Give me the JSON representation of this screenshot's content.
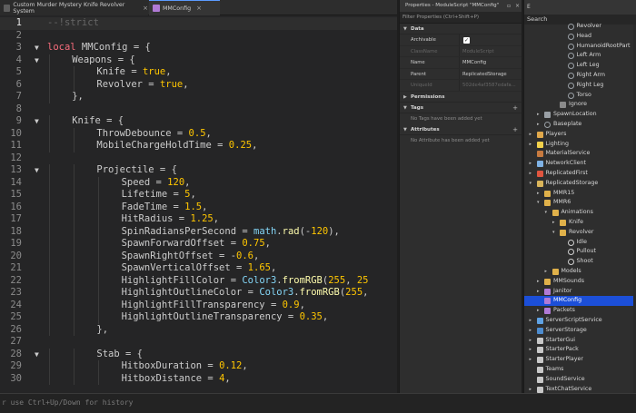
{
  "tabs": [
    {
      "label": "Custom Murder Mystery Knife Revolver System",
      "close": "×"
    },
    {
      "label": "MMConfig",
      "close": "×"
    }
  ],
  "code": [
    {
      "n": "1",
      "fold": "",
      "indent": 0,
      "toks": [
        [
          "cm",
          "--!strict"
        ]
      ]
    },
    {
      "n": "2",
      "fold": "",
      "indent": 0,
      "toks": []
    },
    {
      "n": "3",
      "fold": "▼",
      "indent": 0,
      "toks": [
        [
          "kw",
          "local"
        ],
        [
          "pl",
          " MMConfig = {"
        ]
      ]
    },
    {
      "n": "4",
      "fold": "▼",
      "indent": 1,
      "toks": [
        [
          "pl",
          "Weapons = {"
        ]
      ]
    },
    {
      "n": "5",
      "fold": "",
      "indent": 2,
      "toks": [
        [
          "pl",
          "Knife = "
        ],
        [
          "lit",
          "true"
        ],
        [
          "pl",
          ","
        ]
      ]
    },
    {
      "n": "6",
      "fold": "",
      "indent": 2,
      "toks": [
        [
          "pl",
          "Revolver = "
        ],
        [
          "lit",
          "true"
        ],
        [
          "pl",
          ","
        ]
      ]
    },
    {
      "n": "7",
      "fold": "",
      "indent": 1,
      "toks": [
        [
          "pl",
          "},"
        ]
      ]
    },
    {
      "n": "8",
      "fold": "",
      "indent": 0,
      "toks": []
    },
    {
      "n": "9",
      "fold": "▼",
      "indent": 1,
      "toks": [
        [
          "pl",
          "Knife = {"
        ]
      ]
    },
    {
      "n": "10",
      "fold": "",
      "indent": 2,
      "toks": [
        [
          "pl",
          "ThrowDebounce = "
        ],
        [
          "num",
          "0.5"
        ],
        [
          "pl",
          ","
        ]
      ]
    },
    {
      "n": "11",
      "fold": "",
      "indent": 2,
      "toks": [
        [
          "pl",
          "MobileChargeHoldTime = "
        ],
        [
          "num",
          "0.25"
        ],
        [
          "pl",
          ","
        ]
      ]
    },
    {
      "n": "12",
      "fold": "",
      "indent": 0,
      "toks": []
    },
    {
      "n": "13",
      "fold": "▼",
      "indent": 2,
      "toks": [
        [
          "pl",
          "Projectile = {"
        ]
      ]
    },
    {
      "n": "14",
      "fold": "",
      "indent": 3,
      "toks": [
        [
          "pl",
          "Speed = "
        ],
        [
          "num",
          "120"
        ],
        [
          "pl",
          ","
        ]
      ]
    },
    {
      "n": "15",
      "fold": "",
      "indent": 3,
      "toks": [
        [
          "pl",
          "Lifetime = "
        ],
        [
          "num",
          "5"
        ],
        [
          "pl",
          ","
        ]
      ]
    },
    {
      "n": "16",
      "fold": "",
      "indent": 3,
      "toks": [
        [
          "pl",
          "FadeTime = "
        ],
        [
          "num",
          "1.5"
        ],
        [
          "pl",
          ","
        ]
      ]
    },
    {
      "n": "17",
      "fold": "",
      "indent": 3,
      "toks": [
        [
          "pl",
          "HitRadius = "
        ],
        [
          "num",
          "1.25"
        ],
        [
          "pl",
          ","
        ]
      ]
    },
    {
      "n": "18",
      "fold": "",
      "indent": 3,
      "toks": [
        [
          "pl",
          "SpinRadiansPerSecond = "
        ],
        [
          "bi",
          "math"
        ],
        [
          "pl",
          "."
        ],
        [
          "fn",
          "rad"
        ],
        [
          "pl",
          "(-"
        ],
        [
          "num",
          "120"
        ],
        [
          "pl",
          "),"
        ]
      ]
    },
    {
      "n": "19",
      "fold": "",
      "indent": 3,
      "toks": [
        [
          "pl",
          "SpawnForwardOffset = "
        ],
        [
          "num",
          "0.75"
        ],
        [
          "pl",
          ","
        ]
      ]
    },
    {
      "n": "20",
      "fold": "",
      "indent": 3,
      "toks": [
        [
          "pl",
          "SpawnRightOffset = -"
        ],
        [
          "num",
          "0.6"
        ],
        [
          "pl",
          ","
        ]
      ]
    },
    {
      "n": "21",
      "fold": "",
      "indent": 3,
      "toks": [
        [
          "pl",
          "SpawnVerticalOffset = "
        ],
        [
          "num",
          "1.65"
        ],
        [
          "pl",
          ","
        ]
      ]
    },
    {
      "n": "22",
      "fold": "",
      "indent": 3,
      "toks": [
        [
          "pl",
          "HighlightFillColor = "
        ],
        [
          "bi",
          "Color3"
        ],
        [
          "pl",
          "."
        ],
        [
          "fn",
          "fromRGB"
        ],
        [
          "pl",
          "("
        ],
        [
          "num",
          "255"
        ],
        [
          "pl",
          ", "
        ],
        [
          "num",
          "25"
        ]
      ]
    },
    {
      "n": "23",
      "fold": "",
      "indent": 3,
      "toks": [
        [
          "pl",
          "HighlightOutlineColor = "
        ],
        [
          "bi",
          "Color3"
        ],
        [
          "pl",
          "."
        ],
        [
          "fn",
          "fromRGB"
        ],
        [
          "pl",
          "("
        ],
        [
          "num",
          "255"
        ],
        [
          "pl",
          ","
        ]
      ]
    },
    {
      "n": "24",
      "fold": "",
      "indent": 3,
      "toks": [
        [
          "pl",
          "HighlightFillTransparency = "
        ],
        [
          "num",
          "0.9"
        ],
        [
          "pl",
          ","
        ]
      ]
    },
    {
      "n": "25",
      "fold": "",
      "indent": 3,
      "toks": [
        [
          "pl",
          "HighlightOutlineTransparency = "
        ],
        [
          "num",
          "0.35"
        ],
        [
          "pl",
          ","
        ]
      ]
    },
    {
      "n": "26",
      "fold": "",
      "indent": 2,
      "toks": [
        [
          "pl",
          "},"
        ]
      ]
    },
    {
      "n": "27",
      "fold": "",
      "indent": 0,
      "toks": []
    },
    {
      "n": "28",
      "fold": "▼",
      "indent": 2,
      "toks": [
        [
          "pl",
          "Stab = {"
        ]
      ]
    },
    {
      "n": "29",
      "fold": "",
      "indent": 3,
      "toks": [
        [
          "pl",
          "HitboxDuration = "
        ],
        [
          "num",
          "0.12"
        ],
        [
          "pl",
          ","
        ]
      ]
    },
    {
      "n": "30",
      "fold": "",
      "indent": 3,
      "toks": [
        [
          "pl",
          "HitboxDistance = "
        ],
        [
          "num",
          "4"
        ],
        [
          "pl",
          ","
        ]
      ]
    }
  ],
  "properties": {
    "title": "Properties - ModuleScript \"MMConfig\"",
    "filter": "Filter Properties (Ctrl+Shift+P)",
    "data_section": "Data",
    "rows": [
      {
        "key": "Archivable",
        "value": "",
        "checkbox": true,
        "dim": false
      },
      {
        "key": "ClassName",
        "value": "ModuleScript",
        "dim": true
      },
      {
        "key": "Name",
        "value": "MMConfig",
        "dim": false
      },
      {
        "key": "Parent",
        "value": "ReplicatedStorage",
        "dim": false
      },
      {
        "key": "UniqueId",
        "value": "502de4af3587edafa...",
        "dim": true
      }
    ],
    "permissions_section": "Permissions",
    "tags_section": "Tags",
    "tags_empty": "No Tags have been added yet",
    "attributes_section": "Attributes",
    "attributes_empty": "No Attribute has been added yet"
  },
  "explorer": {
    "header": "E",
    "search": "Search",
    "nodes": [
      {
        "label": "Revolver",
        "depth": 5,
        "exp": "",
        "icon": "part-icon",
        "color": "#9aa0a6"
      },
      {
        "label": "Head",
        "depth": 5,
        "exp": "",
        "icon": "part-icon",
        "color": "#9aa0a6"
      },
      {
        "label": "HumanoidRootPart",
        "depth": 5,
        "exp": "",
        "icon": "part-icon",
        "color": "#9aa0a6"
      },
      {
        "label": "Left Arm",
        "depth": 5,
        "exp": "",
        "icon": "part-icon",
        "color": "#9aa0a6"
      },
      {
        "label": "Left Leg",
        "depth": 5,
        "exp": "",
        "icon": "part-icon",
        "color": "#9aa0a6"
      },
      {
        "label": "Right Arm",
        "depth": 5,
        "exp": "",
        "icon": "part-icon",
        "color": "#9aa0a6"
      },
      {
        "label": "Right Leg",
        "depth": 5,
        "exp": "",
        "icon": "part-icon",
        "color": "#9aa0a6"
      },
      {
        "label": "Torso",
        "depth": 5,
        "exp": "",
        "icon": "part-icon",
        "color": "#9aa0a6"
      },
      {
        "label": "Ignore",
        "depth": 4,
        "exp": "",
        "icon": "folder-icon",
        "color": "#8a8a8a"
      },
      {
        "label": "SpawnLocation",
        "depth": 2,
        "exp": "▸",
        "icon": "spawn-icon",
        "color": "#9aa0a6"
      },
      {
        "label": "Baseplate",
        "depth": 2,
        "exp": "▸",
        "icon": "part-icon",
        "color": "#9aa0a6"
      },
      {
        "label": "Players",
        "depth": 1,
        "exp": "▸",
        "icon": "players-icon",
        "color": "#e0a84b"
      },
      {
        "label": "Lighting",
        "depth": 1,
        "exp": "▸",
        "icon": "lighting-icon",
        "color": "#f2d14b"
      },
      {
        "label": "MaterialService",
        "depth": 1,
        "exp": "",
        "icon": "material-icon",
        "color": "#c77a3f"
      },
      {
        "label": "NetworkClient",
        "depth": 1,
        "exp": "▸",
        "icon": "network-icon",
        "color": "#7fb2e5"
      },
      {
        "label": "ReplicatedFirst",
        "depth": 1,
        "exp": "▸",
        "icon": "replicated-first-icon",
        "color": "#e0553f"
      },
      {
        "label": "ReplicatedStorage",
        "depth": 1,
        "exp": "▾",
        "icon": "replicated-storage-icon",
        "color": "#d9b45a"
      },
      {
        "label": "MMR15",
        "depth": 2,
        "exp": "▸",
        "icon": "folder-icon",
        "color": "#e0b14a"
      },
      {
        "label": "MMR6",
        "depth": 2,
        "exp": "▾",
        "icon": "folder-icon",
        "color": "#e0b14a"
      },
      {
        "label": "Animations",
        "depth": 3,
        "exp": "▾",
        "icon": "folder-icon",
        "color": "#e0b14a"
      },
      {
        "label": "Knife",
        "depth": 4,
        "exp": "▸",
        "icon": "folder-icon",
        "color": "#e0b14a"
      },
      {
        "label": "Revolver",
        "depth": 4,
        "exp": "▾",
        "icon": "folder-icon",
        "color": "#e0b14a"
      },
      {
        "label": "Idle",
        "depth": 5,
        "exp": "",
        "icon": "animation-icon",
        "color": "#cfcfcf"
      },
      {
        "label": "Pullout",
        "depth": 5,
        "exp": "",
        "icon": "animation-icon",
        "color": "#cfcfcf"
      },
      {
        "label": "Shoot",
        "depth": 5,
        "exp": "",
        "icon": "animation-icon",
        "color": "#cfcfcf"
      },
      {
        "label": "Models",
        "depth": 3,
        "exp": "▸",
        "icon": "folder-icon",
        "color": "#e0b14a"
      },
      {
        "label": "MMSounds",
        "depth": 2,
        "exp": "▸",
        "icon": "folder-icon",
        "color": "#e0b14a"
      },
      {
        "label": "Janitor",
        "depth": 2,
        "exp": "▸",
        "icon": "modulescript-icon",
        "color": "#b07ad6"
      },
      {
        "label": "MMConfig",
        "depth": 2,
        "exp": "",
        "icon": "modulescript-icon",
        "color": "#b07ad6",
        "selected": true
      },
      {
        "label": "Packets",
        "depth": 2,
        "exp": "▸",
        "icon": "modulescript-icon",
        "color": "#b07ad6"
      },
      {
        "label": "ServerScriptService",
        "depth": 1,
        "exp": "▸",
        "icon": "server-script-service-icon",
        "color": "#5fa2e3"
      },
      {
        "label": "ServerStorage",
        "depth": 1,
        "exp": "▸",
        "icon": "server-storage-icon",
        "color": "#4d8ccf"
      },
      {
        "label": "StarterGui",
        "depth": 1,
        "exp": "▸",
        "icon": "starter-gui-icon",
        "color": "#c8c8c8"
      },
      {
        "label": "StarterPack",
        "depth": 1,
        "exp": "▸",
        "icon": "starter-pack-icon",
        "color": "#c8c8c8"
      },
      {
        "label": "StarterPlayer",
        "depth": 1,
        "exp": "▸",
        "icon": "starter-player-icon",
        "color": "#c8c8c8"
      },
      {
        "label": "Teams",
        "depth": 1,
        "exp": "",
        "icon": "teams-icon",
        "color": "#c8c8c8"
      },
      {
        "label": "SoundService",
        "depth": 1,
        "exp": "",
        "icon": "sound-service-icon",
        "color": "#c8c8c8"
      },
      {
        "label": "TextChatService",
        "depth": 1,
        "exp": "▸",
        "icon": "text-chat-service-icon",
        "color": "#c8c8c8"
      }
    ]
  },
  "command_bar": {
    "hint": "r use Ctrl+Up/Down for history"
  }
}
